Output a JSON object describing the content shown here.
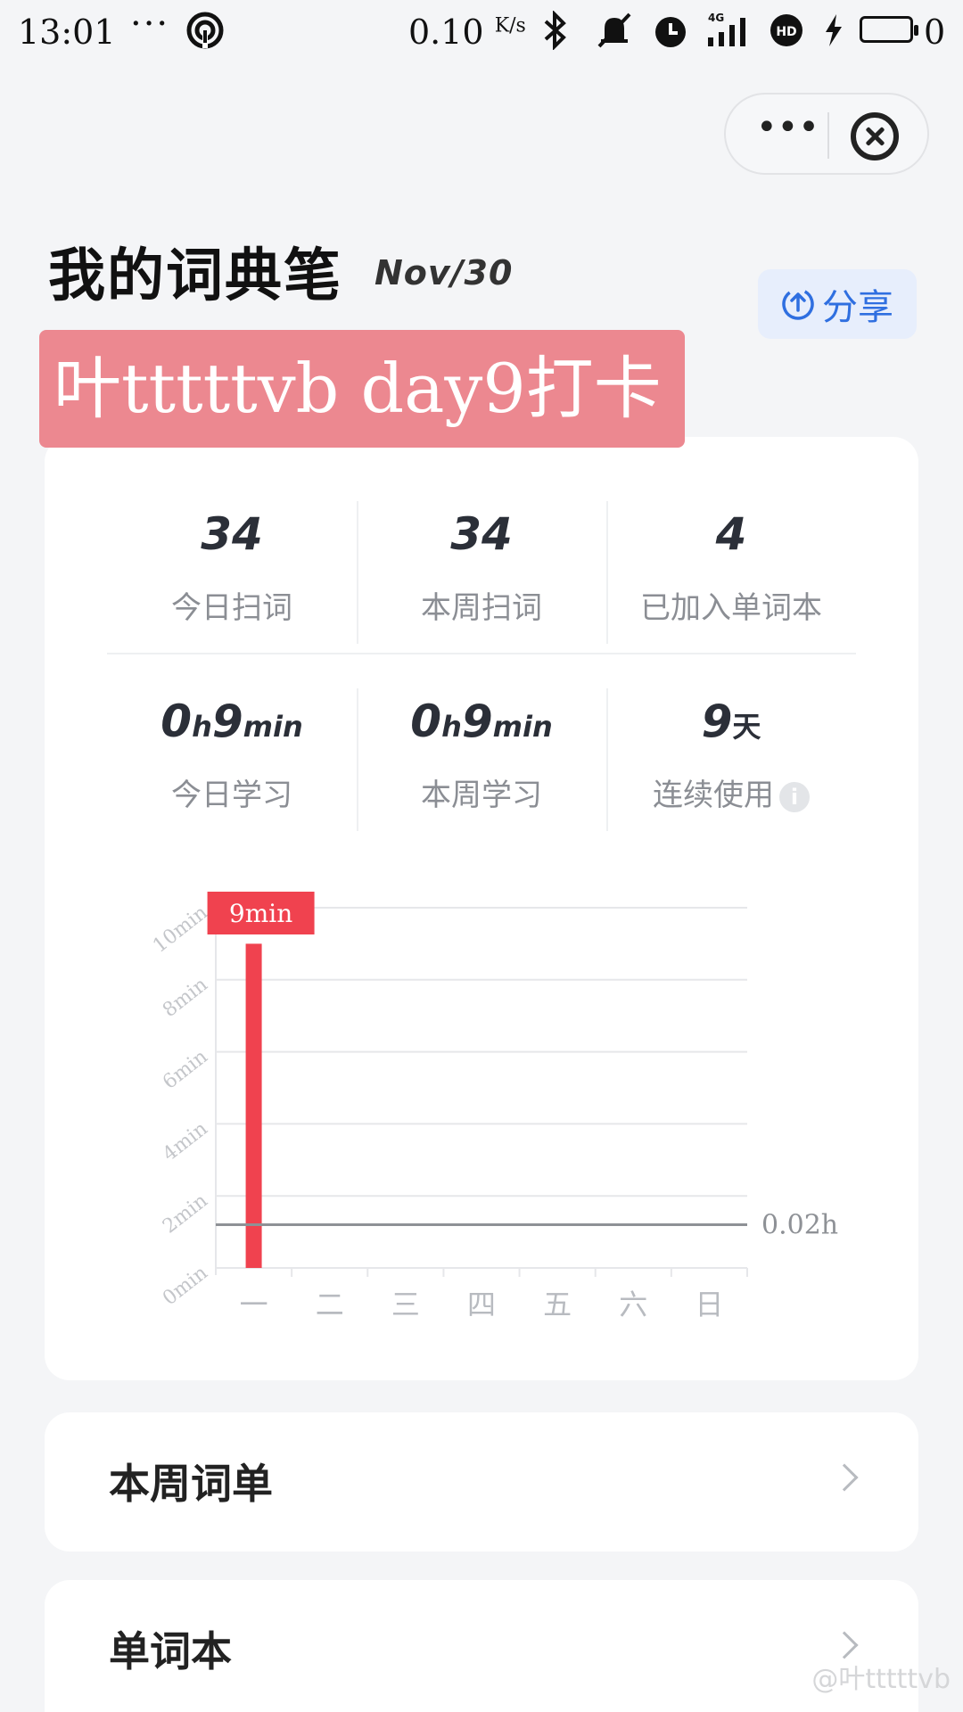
{
  "status_bar": {
    "time": "13:01",
    "dots": "···",
    "speed": "0.10",
    "speed_unit": "K/s",
    "signal": "4G",
    "battery": "0"
  },
  "header": {
    "title": "我的词典笔",
    "date": "Nov/30",
    "share_label": "分享"
  },
  "banner": {
    "text": "叶tttttvb day9打卡"
  },
  "stats": {
    "row1": [
      {
        "value": "34",
        "label": "今日扫词"
      },
      {
        "value": "34",
        "label": "本周扫词"
      },
      {
        "value": "4",
        "label": "已加入单词本"
      }
    ],
    "row2": [
      {
        "value_h": "0",
        "unit_h": "h",
        "value_m": "9",
        "unit_m": "min",
        "label": "今日学习"
      },
      {
        "value_h": "0",
        "unit_h": "h",
        "value_m": "9",
        "unit_m": "min",
        "label": "本周学习"
      },
      {
        "value": "9",
        "unit": "天",
        "label": "连续使用",
        "info": "i"
      }
    ]
  },
  "chart_data": {
    "type": "bar",
    "categories": [
      "一",
      "二",
      "三",
      "四",
      "五",
      "六",
      "日"
    ],
    "values": [
      9,
      0,
      0,
      0,
      0,
      0,
      0
    ],
    "y_ticks": [
      "0min",
      "2min",
      "4min",
      "6min",
      "8min",
      "10min"
    ],
    "ylim": [
      0,
      10
    ],
    "bar_label": "9min",
    "reference_line": {
      "value_min": 1.2,
      "label": "0.02h"
    },
    "bar_color": "#f0424f",
    "grid": true
  },
  "lists": [
    {
      "label": "本周词单"
    },
    {
      "label": "单词本"
    }
  ],
  "watermark": "@叶tttttvb",
  "colors": {
    "accent": "#2f6fe0",
    "banner": "#ec8890",
    "bar": "#f0424f"
  }
}
